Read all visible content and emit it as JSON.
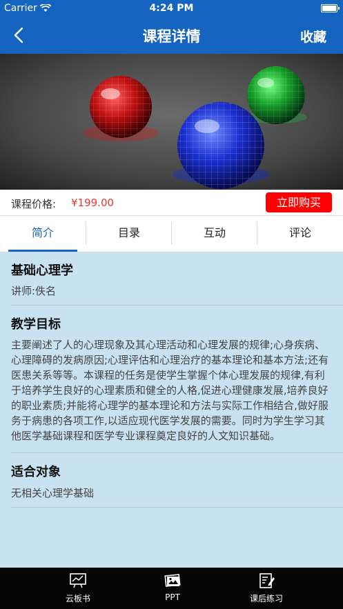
{
  "status": {
    "carrier": "Carrier",
    "time": "4:24 PM"
  },
  "nav": {
    "title": "课程详情",
    "favorite": "收藏"
  },
  "price": {
    "label": "课程价格:",
    "value": "¥199.00",
    "buy": "立即购买"
  },
  "tabs": [
    {
      "label": "简介",
      "active": true
    },
    {
      "label": "目录",
      "active": false
    },
    {
      "label": "互动",
      "active": false
    },
    {
      "label": "评论",
      "active": false
    }
  ],
  "course": {
    "title": "基础心理学",
    "teacher": "讲师:佚名"
  },
  "goal": {
    "heading": "教学目标",
    "text": "主要阐述了人的心理现象及其心理活动和心理发展的规律;心身疾病、心理障碍的发病原因;心理评估和心理治疗的基本理论和基本方法;还有医患关系等等。本课程的任务是使学生掌握个体心理发展的规律,有利于培养学生良好的心理素质和健全的人格,促进心理健康发展,培养良好的职业素质;并能将心理学的基本理论和方法与实际工作相结合,做好服务于病患的各项工作,以适应现代医学发展的需要。同时为学生学习其他医学基础课程和医学专业课程奠定良好的人文知识基础。"
  },
  "audience": {
    "heading": "适合对象",
    "text": "无相关心理学基础"
  },
  "bottom_tabs": [
    {
      "label": "云板书",
      "icon": "whiteboard-icon"
    },
    {
      "label": "PPT",
      "icon": "ppt-icon"
    },
    {
      "label": "课后练习",
      "icon": "exercise-icon"
    }
  ],
  "colors": {
    "primary": "#1565c0",
    "price": "#e53935",
    "buy": "#ff0000",
    "content_bg": "#c9e2f2"
  }
}
